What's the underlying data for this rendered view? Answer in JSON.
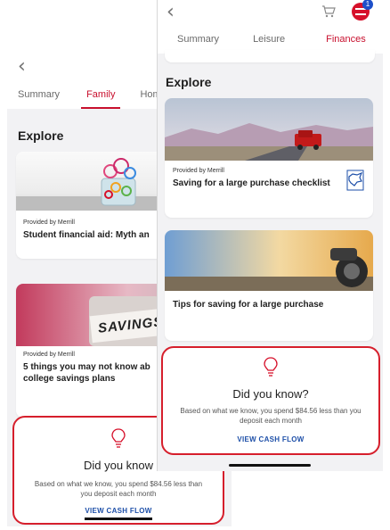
{
  "back_screen": {
    "tabs": [
      {
        "label": "Summary",
        "active": false
      },
      {
        "label": "Family",
        "active": true
      },
      {
        "label": "Home",
        "active": false
      }
    ],
    "section_title": "Explore",
    "cards": [
      {
        "provider": "Provided by Merrill",
        "title": "Student financial aid: Myth an",
        "image": "paper-clips-jar"
      },
      {
        "provider": "Provided by Merrill",
        "title": "5 things you may not know ab college savings plans",
        "image": "savings-jar",
        "image_text": "SAVINGS"
      }
    ],
    "insight": {
      "icon": "lightbulb-icon",
      "title": "Did you know",
      "text": "Based on what we know, you spend $84.56 less than you deposit each month",
      "link": "VIEW CASH FLOW"
    }
  },
  "front_screen": {
    "header": {
      "back_icon": "chevron-left-icon",
      "cart_icon": "cart-icon",
      "badge_count": "1"
    },
    "tabs": [
      {
        "label": "Summary",
        "active": false
      },
      {
        "label": "Leisure",
        "active": false
      },
      {
        "label": "Finances",
        "active": true
      }
    ],
    "section_title": "Explore",
    "cards": [
      {
        "provider": "Provided by Merrill",
        "title": "Saving for a large purchase checklist",
        "image": "red-truck-on-road",
        "logo": "merrill-bull-logo"
      },
      {
        "title": "Tips for saving for a large purchase",
        "image": "motorcycle-sunset"
      }
    ],
    "insight": {
      "icon": "lightbulb-icon",
      "title": "Did you know?",
      "text": "Based on what we know, you spend $84.56 less than you deposit each month",
      "link": "VIEW CASH FLOW"
    }
  },
  "colors": {
    "accent_red": "#c8102e",
    "highlight_outline": "#d61f2c",
    "link_blue": "#1d4fa8",
    "page_bg": "#f2f2f4"
  }
}
